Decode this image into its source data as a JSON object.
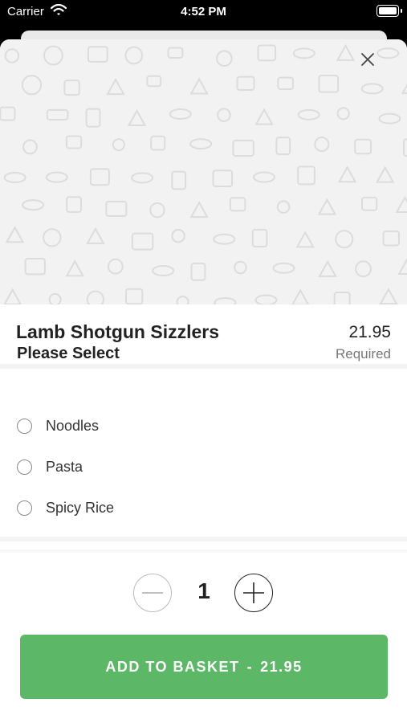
{
  "status_bar": {
    "carrier": "Carrier",
    "time": "4:52 PM"
  },
  "item": {
    "name": "Lamb Shotgun Sizzlers",
    "price": "21.95"
  },
  "options": {
    "title": "Please Select",
    "required_label": "Required",
    "choices": [
      {
        "label": "Noodles"
      },
      {
        "label": "Pasta"
      },
      {
        "label": "Spicy Rice"
      }
    ]
  },
  "quantity": {
    "value": "1"
  },
  "add_button": {
    "label": "ADD TO BASKET",
    "separator": "-",
    "price": "21.95"
  },
  "colors": {
    "accent": "#5cb866",
    "hero_background": "#f2f2f2"
  },
  "icons": [
    "wifi-icon",
    "battery-icon",
    "close-icon",
    "minus-icon",
    "plus-icon",
    "food-doodle-pattern"
  ]
}
